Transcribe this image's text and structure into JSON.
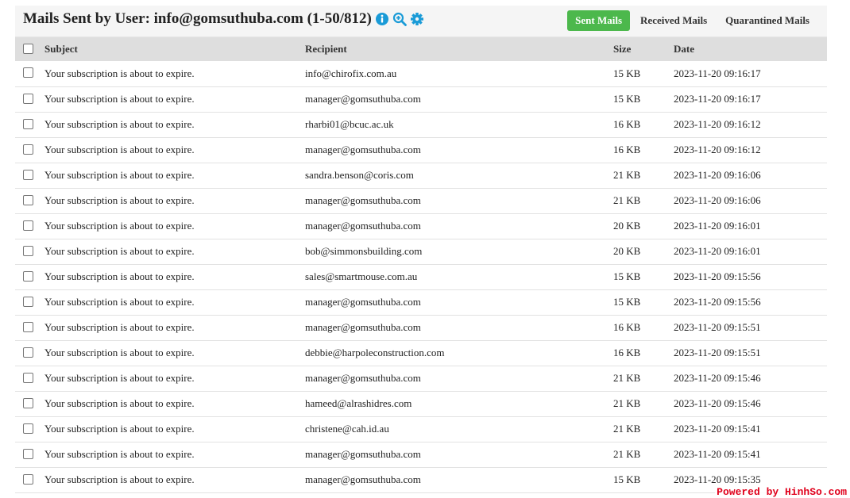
{
  "header": {
    "title": "Mails Sent by User: info@gomsuthuba.com (1-50/812)",
    "icons": [
      "info-icon",
      "zoom-in-icon",
      "gear-icon"
    ],
    "icon_color": "#1a9bd7"
  },
  "tabs": [
    {
      "label": "Sent Mails",
      "active": true
    },
    {
      "label": "Received Mails",
      "active": false
    },
    {
      "label": "Quarantined Mails",
      "active": false
    }
  ],
  "table": {
    "columns": {
      "subject": "Subject",
      "recipient": "Recipient",
      "size": "Size",
      "date": "Date"
    },
    "rows": [
      {
        "subject": "Your subscription is about to expire.",
        "recipient": "info@chirofix.com.au",
        "size": "15 KB",
        "date": "2023-11-20 09:16:17"
      },
      {
        "subject": "Your subscription is about to expire.",
        "recipient": "manager@gomsuthuba.com",
        "size": "15 KB",
        "date": "2023-11-20 09:16:17"
      },
      {
        "subject": "Your subscription is about to expire.",
        "recipient": "rharbi01@bcuc.ac.uk",
        "size": "16 KB",
        "date": "2023-11-20 09:16:12"
      },
      {
        "subject": "Your subscription is about to expire.",
        "recipient": "manager@gomsuthuba.com",
        "size": "16 KB",
        "date": "2023-11-20 09:16:12"
      },
      {
        "subject": "Your subscription is about to expire.",
        "recipient": "sandra.benson@coris.com",
        "size": "21 KB",
        "date": "2023-11-20 09:16:06"
      },
      {
        "subject": "Your subscription is about to expire.",
        "recipient": "manager@gomsuthuba.com",
        "size": "21 KB",
        "date": "2023-11-20 09:16:06"
      },
      {
        "subject": "Your subscription is about to expire.",
        "recipient": "manager@gomsuthuba.com",
        "size": "20 KB",
        "date": "2023-11-20 09:16:01"
      },
      {
        "subject": "Your subscription is about to expire.",
        "recipient": "bob@simmonsbuilding.com",
        "size": "20 KB",
        "date": "2023-11-20 09:16:01"
      },
      {
        "subject": "Your subscription is about to expire.",
        "recipient": "sales@smartmouse.com.au",
        "size": "15 KB",
        "date": "2023-11-20 09:15:56"
      },
      {
        "subject": "Your subscription is about to expire.",
        "recipient": "manager@gomsuthuba.com",
        "size": "15 KB",
        "date": "2023-11-20 09:15:56"
      },
      {
        "subject": "Your subscription is about to expire.",
        "recipient": "manager@gomsuthuba.com",
        "size": "16 KB",
        "date": "2023-11-20 09:15:51"
      },
      {
        "subject": "Your subscription is about to expire.",
        "recipient": "debbie@harpoleconstruction.com",
        "size": "16 KB",
        "date": "2023-11-20 09:15:51"
      },
      {
        "subject": "Your subscription is about to expire.",
        "recipient": "manager@gomsuthuba.com",
        "size": "21 KB",
        "date": "2023-11-20 09:15:46"
      },
      {
        "subject": "Your subscription is about to expire.",
        "recipient": "hameed@alrashidres.com",
        "size": "21 KB",
        "date": "2023-11-20 09:15:46"
      },
      {
        "subject": "Your subscription is about to expire.",
        "recipient": "christene@cah.id.au",
        "size": "21 KB",
        "date": "2023-11-20 09:15:41"
      },
      {
        "subject": "Your subscription is about to expire.",
        "recipient": "manager@gomsuthuba.com",
        "size": "21 KB",
        "date": "2023-11-20 09:15:41"
      },
      {
        "subject": "Your subscription is about to expire.",
        "recipient": "manager@gomsuthuba.com",
        "size": "15 KB",
        "date": "2023-11-20 09:15:35"
      }
    ]
  },
  "colors": {
    "active_tab": "#4cb84c",
    "header_row": "#dedede",
    "watermark": "#e0001b"
  },
  "watermark": "Powered by HinhSo.com"
}
